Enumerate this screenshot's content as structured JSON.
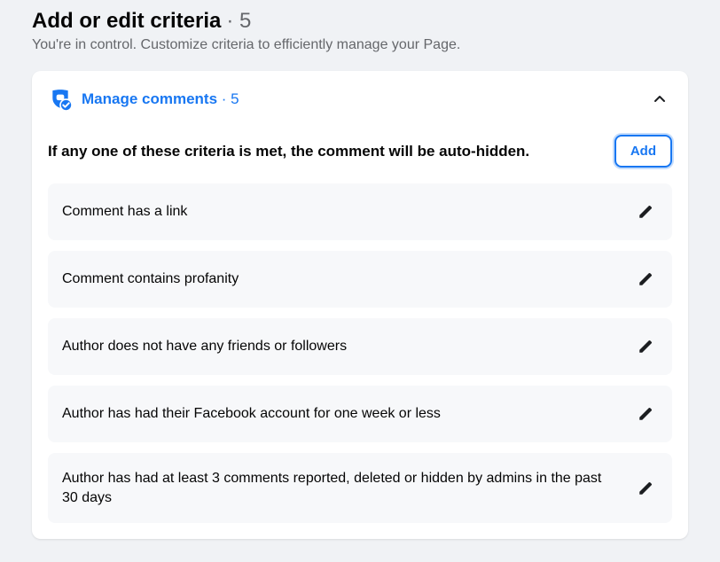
{
  "header": {
    "title": "Add or edit criteria",
    "count": "· 5",
    "subtitle": "You're in control. Customize criteria to efficiently manage your Page."
  },
  "section": {
    "link_label": "Manage comments",
    "count": "· 5",
    "description": "If any one of these criteria is met, the comment will be auto-hidden.",
    "add_label": "Add"
  },
  "criteria": [
    {
      "text": "Comment has a link"
    },
    {
      "text": "Comment contains profanity"
    },
    {
      "text": "Author does not have any friends or followers"
    },
    {
      "text": "Author has had their Facebook account for one week or less"
    },
    {
      "text": "Author has had at least 3 comments reported, deleted or hidden by admins in the past 30 days"
    }
  ],
  "colors": {
    "accent": "#1877f2",
    "text_primary": "#050505",
    "text_secondary": "#65676b",
    "page_bg": "#f0f2f5",
    "card_bg": "#ffffff",
    "item_bg": "#f7f8fa"
  },
  "icons": {
    "shield": "shield-comment-icon",
    "chevron_up": "chevron-up-icon",
    "pencil": "pencil-icon"
  }
}
